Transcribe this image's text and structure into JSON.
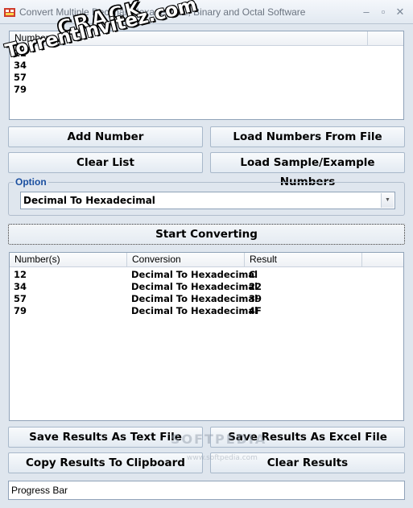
{
  "window": {
    "title": "Convert Multiple Decimal, Hexadecimal, Binary and Octal Software",
    "minimize_glyph": "–",
    "maximize_glyph": "▫",
    "close_glyph": "✕"
  },
  "watermark": {
    "line1": "CRACK",
    "line2": "TorrentInvitez.com",
    "softpedia": "SOFTPEDIA",
    "softpedia_url": "www.softpedia.com"
  },
  "input_list": {
    "header": "Number",
    "items": [
      "12",
      "34",
      "57",
      "79"
    ]
  },
  "buttons": {
    "add_number": "Add Number",
    "load_from_file": "Load Numbers From File",
    "clear_list": "Clear List",
    "load_sample": "Load Sample/Example Numbers",
    "start_converting": "Start Converting",
    "save_text": "Save Results As Text File",
    "save_excel": "Save Results As Excel File",
    "copy_clipboard": "Copy Results To Clipboard",
    "clear_results": "Clear Results"
  },
  "option": {
    "legend": "Option",
    "selected": "Decimal To Hexadecimal"
  },
  "results": {
    "columns": [
      "Number(s)",
      "Conversion",
      "Result"
    ],
    "rows": [
      [
        "12",
        "Decimal To Hexadecimal",
        "C"
      ],
      [
        "34",
        "Decimal To Hexadecimal",
        "22"
      ],
      [
        "57",
        "Decimal To Hexadecimal",
        "39"
      ],
      [
        "79",
        "Decimal To Hexadecimal",
        "4F"
      ]
    ]
  },
  "progress": {
    "label": "Progress Bar"
  },
  "colors": {
    "window_bg": "#dfe6ee",
    "legend_text": "#1a4fa0",
    "border": "#8fa2b8"
  }
}
